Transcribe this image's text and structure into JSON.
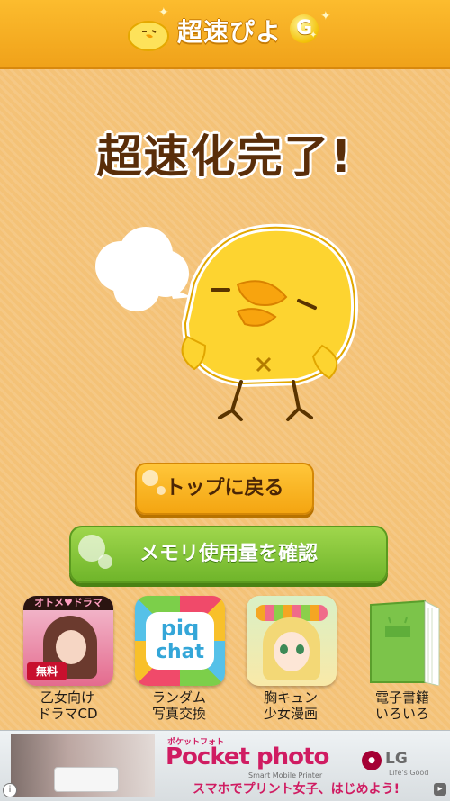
{
  "header": {
    "logo_text": "超速ぴよ",
    "logo_badge": "G"
  },
  "main": {
    "title": "超速化完了!",
    "btn_top": "トップに戻る",
    "btn_memory": "メモリ使用量を確認"
  },
  "apps": [
    {
      "icon_text": "オトメ♥ドラマ",
      "badge": "無料",
      "label": "乙女向け\nドラマCD"
    },
    {
      "icon_text_1": "piq",
      "icon_text_2": "chat",
      "label": "ランダム\n写真交換"
    },
    {
      "label": "胸キュン\n少女漫画"
    },
    {
      "label": "電子書籍\nいろいろ"
    }
  ],
  "ad": {
    "brand_small": "ポケットフォト",
    "brand": "Pocket photo",
    "sub": "Smart Mobile Printer",
    "line": "スマホでプリント女子、はじめよう!",
    "lg": "LG",
    "lg_tag": "Life's Good"
  },
  "colors": {
    "background": "#f4c277",
    "header": "#f7ae22",
    "title_text": "#5a2e0a",
    "btn_top": "#f8b523",
    "btn_memory": "#86c63a",
    "ad_accent": "#d01c62"
  }
}
